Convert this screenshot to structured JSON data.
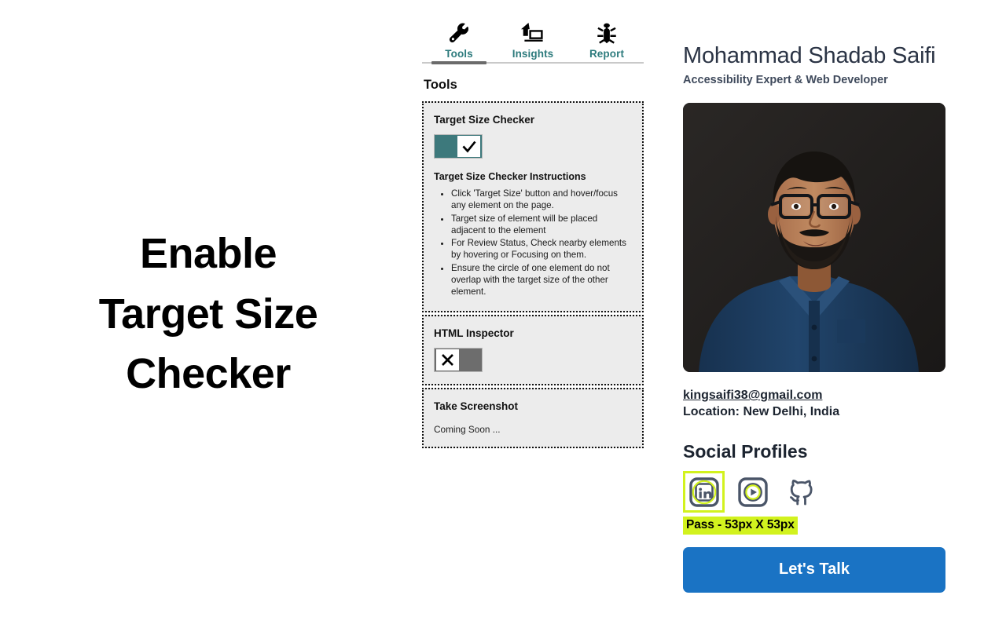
{
  "hero": {
    "lines": [
      "Enable",
      "Target Size",
      "Checker"
    ]
  },
  "extension": {
    "tabs": [
      {
        "label": "Tools",
        "icon": "wrench-icon",
        "active": true
      },
      {
        "label": "Insights",
        "icon": "house-laptop-icon",
        "active": false
      },
      {
        "label": "Report",
        "icon": "bug-icon",
        "active": false
      }
    ],
    "section_title": "Tools",
    "cards": [
      {
        "title": "Target Size Checker",
        "toggle": {
          "state": "on",
          "glyph": "checkmark-icon"
        },
        "instructions_title": "Target Size Checker Instructions",
        "instructions": [
          "Click 'Target Size' button and hover/focus any element on the page.",
          "Target size of element will be placed adjacent to the element",
          "For Review Status, Check nearby elements by hovering or Focusing on them.",
          "Ensure the circle of one element do not overlap with the target size of the other element."
        ]
      },
      {
        "title": "HTML Inspector",
        "toggle": {
          "state": "off",
          "glyph": "cross-icon"
        }
      },
      {
        "title": "Take Screenshot",
        "body": "Coming Soon ..."
      }
    ]
  },
  "profile": {
    "name": "Mohammad Shadab Saifi",
    "role": "Accessibility Expert & Web Developer",
    "photo_alt": "portrait-photo",
    "email": "kingsaifi38@gmail.com",
    "location": "Location: New Delhi, India",
    "social_heading": "Social Profiles",
    "social_links": [
      {
        "name": "linkedin-icon",
        "highlighted": true
      },
      {
        "name": "youtube-icon",
        "highlighted": false
      },
      {
        "name": "github-icon",
        "highlighted": false
      }
    ],
    "size_badge": "Pass - 53px X 53px",
    "cta_label": "Let's Talk"
  },
  "colors": {
    "tab_teal": "#2d7b7d",
    "toggle_on": "#3d797c",
    "toggle_off": "#6d6d6d",
    "highlight_yellow": "#d2f21e",
    "cta_blue": "#1a73c4",
    "icon_slate": "#4a5568"
  }
}
